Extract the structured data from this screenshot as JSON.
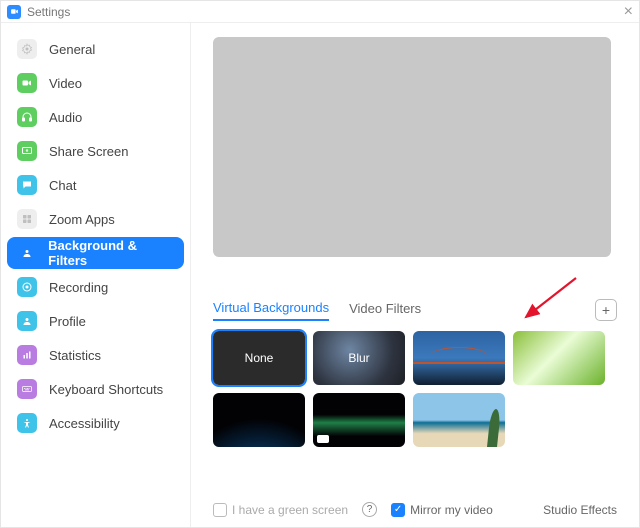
{
  "titlebar": {
    "title": "Settings"
  },
  "sidebar": {
    "items": [
      {
        "label": "General"
      },
      {
        "label": "Video"
      },
      {
        "label": "Audio"
      },
      {
        "label": "Share Screen"
      },
      {
        "label": "Chat"
      },
      {
        "label": "Zoom Apps"
      },
      {
        "label": "Background & Filters"
      },
      {
        "label": "Recording"
      },
      {
        "label": "Profile"
      },
      {
        "label": "Statistics"
      },
      {
        "label": "Keyboard Shortcuts"
      },
      {
        "label": "Accessibility"
      }
    ],
    "active_index": 6
  },
  "tabs": {
    "virtual_backgrounds": "Virtual Backgrounds",
    "video_filters": "Video Filters"
  },
  "thumbs": {
    "none": "None",
    "blur": "Blur"
  },
  "footer": {
    "green_screen": "I have a green screen",
    "mirror": "Mirror my video",
    "mirror_checked": true,
    "studio": "Studio Effects"
  }
}
